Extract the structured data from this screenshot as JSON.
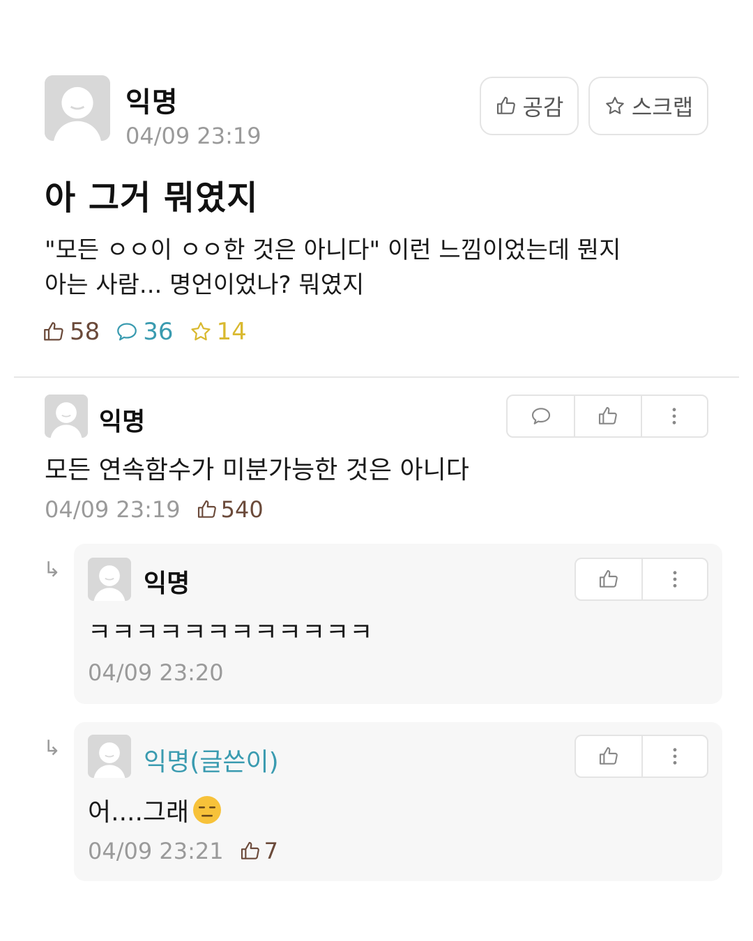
{
  "post": {
    "author": "익명",
    "date": "04/09 23:19",
    "like_button": "공감",
    "scrap_button": "스크랩",
    "title": "아 그거 뭐였지",
    "body_line1": "\"모든 ㅇㅇ이 ㅇㅇ한 것은 아니다\" 이런 느낌이었는데 뭔지",
    "body_line2": "아는 사람... 명언이었나? 뭐였지",
    "stats": {
      "likes": "58",
      "comments": "36",
      "scraps": "14"
    }
  },
  "comments": [
    {
      "author": "익명",
      "text": "모든 연속함수가 미분가능한 것은 아니다",
      "date": "04/09 23:19",
      "likes": "540",
      "replies": [
        {
          "author": "익명",
          "text": "ㅋㅋㅋㅋㅋㅋㅋㅋㅋㅋㅋㅋ",
          "date": "04/09 23:20"
        },
        {
          "author": "익명(글쓴이)",
          "text": "어....그래",
          "date": "04/09 23:21",
          "likes": "7"
        }
      ]
    }
  ],
  "colors": {
    "like": "#6b4a3a",
    "comment": "#3a9bb0",
    "scrap": "#d9b930",
    "op_author": "#3a9bb0",
    "muted": "#9a9a9a"
  },
  "icons": {
    "like": "thumbs-up-icon",
    "comment": "speech-bubble-icon",
    "scrap": "star-icon",
    "more": "more-vertical-icon",
    "reply": "reply-arrow-icon",
    "avatar": "default-avatar-icon",
    "emoji": "expressionless-face-emoji"
  }
}
